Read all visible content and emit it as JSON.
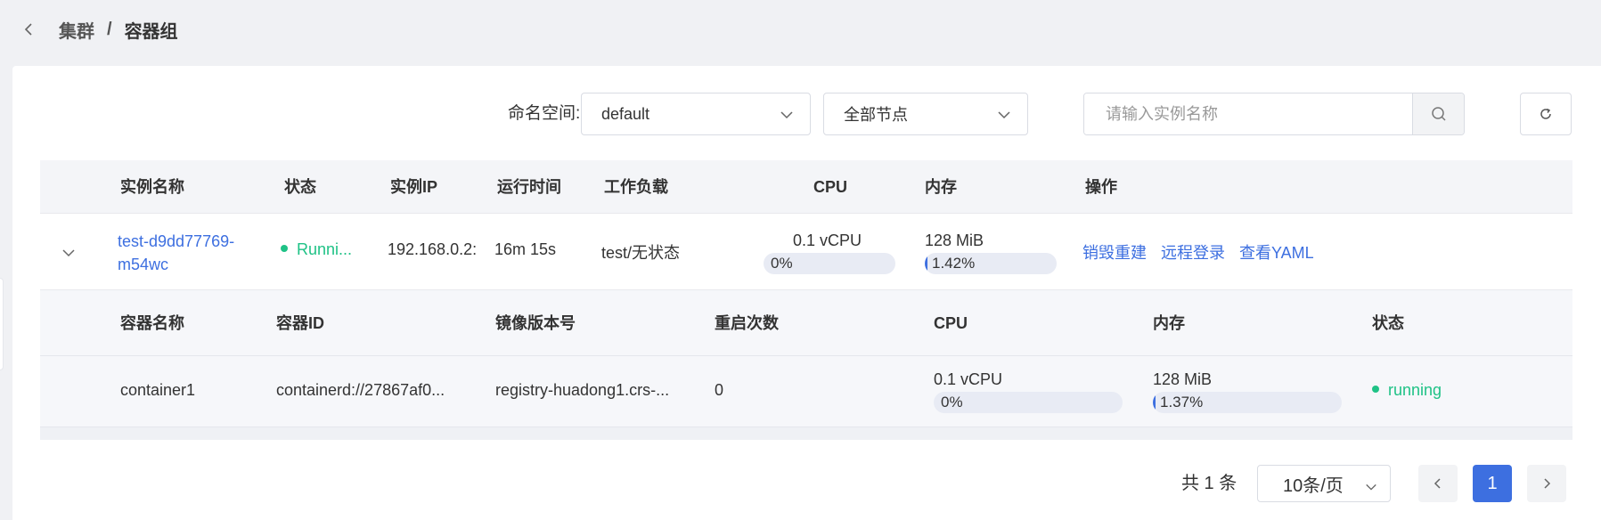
{
  "breadcrumb": {
    "parent": "集群",
    "separator": "/",
    "current": "容器组"
  },
  "filters": {
    "namespace_label": "命名空间:",
    "namespace_value": "default",
    "node_value": "全部节点",
    "search_placeholder": "请输入实例名称"
  },
  "table": {
    "headers": [
      "实例名称",
      "状态",
      "实例IP",
      "运行时间",
      "工作负载",
      "CPU",
      "内存",
      "操作"
    ],
    "row": {
      "name_line1": "test-d9dd77769-",
      "name_line2": "m54wc",
      "status": "Runni...",
      "ip": "192.168.0.2:",
      "uptime": "16m 15s",
      "workload": "test/无状态",
      "cpu_value": "0.1 vCPU",
      "cpu_percent_text": "0%",
      "cpu_percent": 0,
      "mem_value": "128 MiB",
      "mem_percent_text": "1.42%",
      "mem_percent": 1.42,
      "actions": [
        "销毁重建",
        "远程登录",
        "查看YAML"
      ]
    }
  },
  "containers": {
    "headers": [
      "容器名称",
      "容器ID",
      "镜像版本号",
      "重启次数",
      "CPU",
      "内存",
      "状态"
    ],
    "row": {
      "name": "container1",
      "id": "containerd://27867af0...",
      "image": "registry-huadong1.crs-...",
      "restarts": "0",
      "cpu_value": "0.1 vCPU",
      "cpu_percent_text": "0%",
      "cpu_percent": 0,
      "mem_value": "128 MiB",
      "mem_percent_text": "1.37%",
      "mem_percent": 1.37,
      "status": "running"
    }
  },
  "pagination": {
    "total": "共 1 条",
    "page_size": "10条/页",
    "current_page": "1"
  },
  "colors": {
    "accent": "#3d6fe0",
    "success": "#1fc286"
  }
}
